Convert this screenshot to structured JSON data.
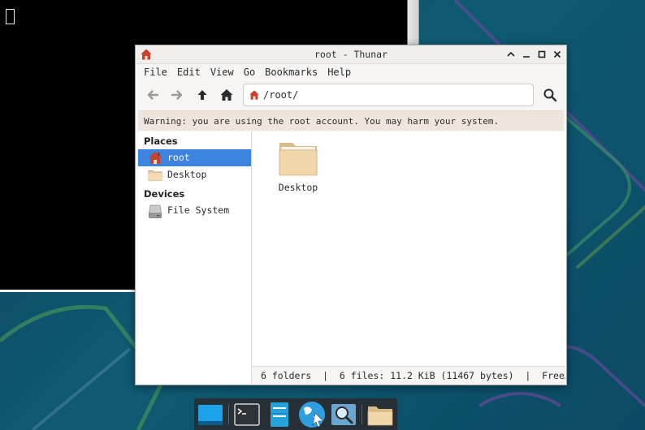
{
  "window": {
    "title": "root - Thunar",
    "menu": [
      "File",
      "Edit",
      "View",
      "Go",
      "Bookmarks",
      "Help"
    ],
    "location_path": "/root/",
    "warning": "Warning: you are using the root account. You may harm your system.",
    "sidebar": {
      "places_title": "Places",
      "places": [
        {
          "label": "root",
          "icon": "home-icon",
          "active": true
        },
        {
          "label": "Desktop",
          "icon": "folder-icon",
          "active": false
        }
      ],
      "devices_title": "Devices",
      "devices": [
        {
          "label": "File System",
          "icon": "drive-icon",
          "active": false
        }
      ]
    },
    "content": {
      "items": [
        {
          "label": "Desktop",
          "icon": "folder-icon"
        }
      ]
    },
    "status": "6 folders  |  6 files: 11.2 KiB (11467 bytes)  |  Free…"
  },
  "dock": {
    "items": [
      "show-desktop-icon",
      "terminal-icon",
      "file-manager-icon",
      "web-browser-icon",
      "app-finder-icon",
      "folder-icon"
    ]
  },
  "colors": {
    "selection": "#3d84e0",
    "warning_bg": "#eee5dc",
    "desktop_bg": "#0e4d67"
  }
}
